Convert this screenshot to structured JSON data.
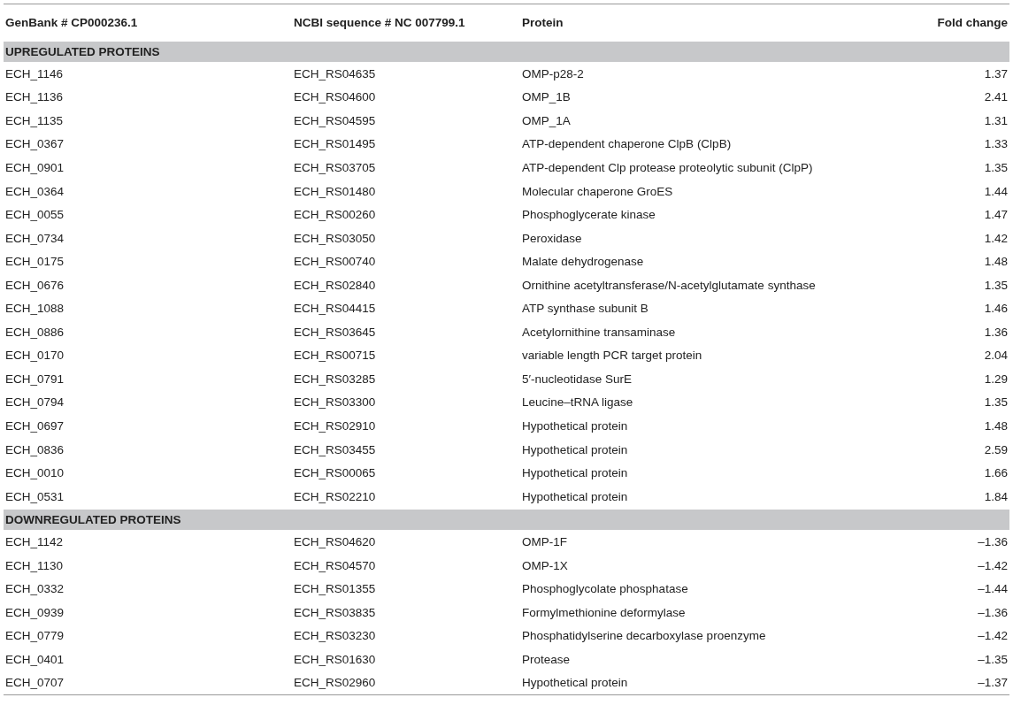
{
  "table": {
    "columns": [
      "GenBank # CP000236.1",
      "NCBI sequence # NC 007799.1",
      "Protein",
      "Fold change"
    ],
    "sections": [
      {
        "title": "UPREGULATED PROTEINS",
        "rows": [
          [
            "ECH_1146",
            "ECH_RS04635",
            "OMP-p28-2",
            "1.37"
          ],
          [
            "ECH_1136",
            "ECH_RS04600",
            "OMP_1B",
            "2.41"
          ],
          [
            "ECH_1135",
            "ECH_RS04595",
            "OMP_1A",
            "1.31"
          ],
          [
            "ECH_0367",
            "ECH_RS01495",
            "ATP-dependent chaperone ClpB (ClpB)",
            "1.33"
          ],
          [
            "ECH_0901",
            "ECH_RS03705",
            "ATP-dependent Clp protease proteolytic subunit (ClpP)",
            "1.35"
          ],
          [
            "ECH_0364",
            "ECH_RS01480",
            "Molecular chaperone GroES",
            "1.44"
          ],
          [
            "ECH_0055",
            "ECH_RS00260",
            "Phosphoglycerate kinase",
            "1.47"
          ],
          [
            "ECH_0734",
            "ECH_RS03050",
            "Peroxidase",
            "1.42"
          ],
          [
            "ECH_0175",
            "ECH_RS00740",
            "Malate dehydrogenase",
            "1.48"
          ],
          [
            "ECH_0676",
            "ECH_RS02840",
            "Ornithine acetyltransferase/N-acetylglutamate synthase",
            "1.35"
          ],
          [
            "ECH_1088",
            "ECH_RS04415",
            "ATP synthase subunit B",
            "1.46"
          ],
          [
            "ECH_0886",
            "ECH_RS03645",
            "Acetylornithine transaminase",
            "1.36"
          ],
          [
            "ECH_0170",
            "ECH_RS00715",
            "variable length PCR target protein",
            "2.04"
          ],
          [
            "ECH_0791",
            "ECH_RS03285",
            "5′-nucleotidase SurE",
            "1.29"
          ],
          [
            "ECH_0794",
            "ECH_RS03300",
            "Leucine–tRNA ligase",
            "1.35"
          ],
          [
            "ECH_0697",
            "ECH_RS02910",
            "Hypothetical protein",
            "1.48"
          ],
          [
            "ECH_0836",
            "ECH_RS03455",
            "Hypothetical protein",
            "2.59"
          ],
          [
            "ECH_0010",
            "ECH_RS00065",
            "Hypothetical protein",
            "1.66"
          ],
          [
            "ECH_0531",
            "ECH_RS02210",
            "Hypothetical protein",
            "1.84"
          ]
        ]
      },
      {
        "title": "DOWNREGULATED PROTEINS",
        "rows": [
          [
            "ECH_1142",
            "ECH_RS04620",
            "OMP-1F",
            "–1.36"
          ],
          [
            "ECH_1130",
            "ECH_RS04570",
            "OMP-1X",
            "–1.42"
          ],
          [
            "ECH_0332",
            "ECH_RS01355",
            "Phosphoglycolate phosphatase",
            "–1.44"
          ],
          [
            "ECH_0939",
            "ECH_RS03835",
            "Formylmethionine deformylase",
            "–1.36"
          ],
          [
            "ECH_0779",
            "ECH_RS03230",
            "Phosphatidylserine decarboxylase proenzyme",
            "–1.42"
          ],
          [
            "ECH_0401",
            "ECH_RS01630",
            "Protease",
            "–1.35"
          ],
          [
            "ECH_0707",
            "ECH_RS02960",
            "Hypothetical protein",
            "–1.37"
          ]
        ]
      }
    ]
  }
}
